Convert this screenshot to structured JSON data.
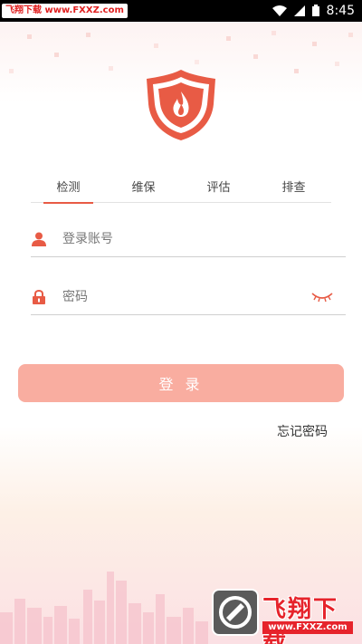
{
  "status_bar": {
    "watermark": "飞翔下载 www.FXXZ.com",
    "time": "8:45"
  },
  "tabs": [
    {
      "label": "检测",
      "active": true
    },
    {
      "label": "维保",
      "active": false
    },
    {
      "label": "评估",
      "active": false
    },
    {
      "label": "排查",
      "active": false
    }
  ],
  "login_form": {
    "account_placeholder": "登录账号",
    "password_placeholder": "密码",
    "submit_label": "登 录",
    "forgot_label": "忘记密码"
  },
  "watermark": {
    "title": "飞翔下载",
    "url": "www.FXXZ.com"
  },
  "colors": {
    "accent": "#e85b45",
    "button": "#f9ada0",
    "brand_red": "#e6232b"
  }
}
